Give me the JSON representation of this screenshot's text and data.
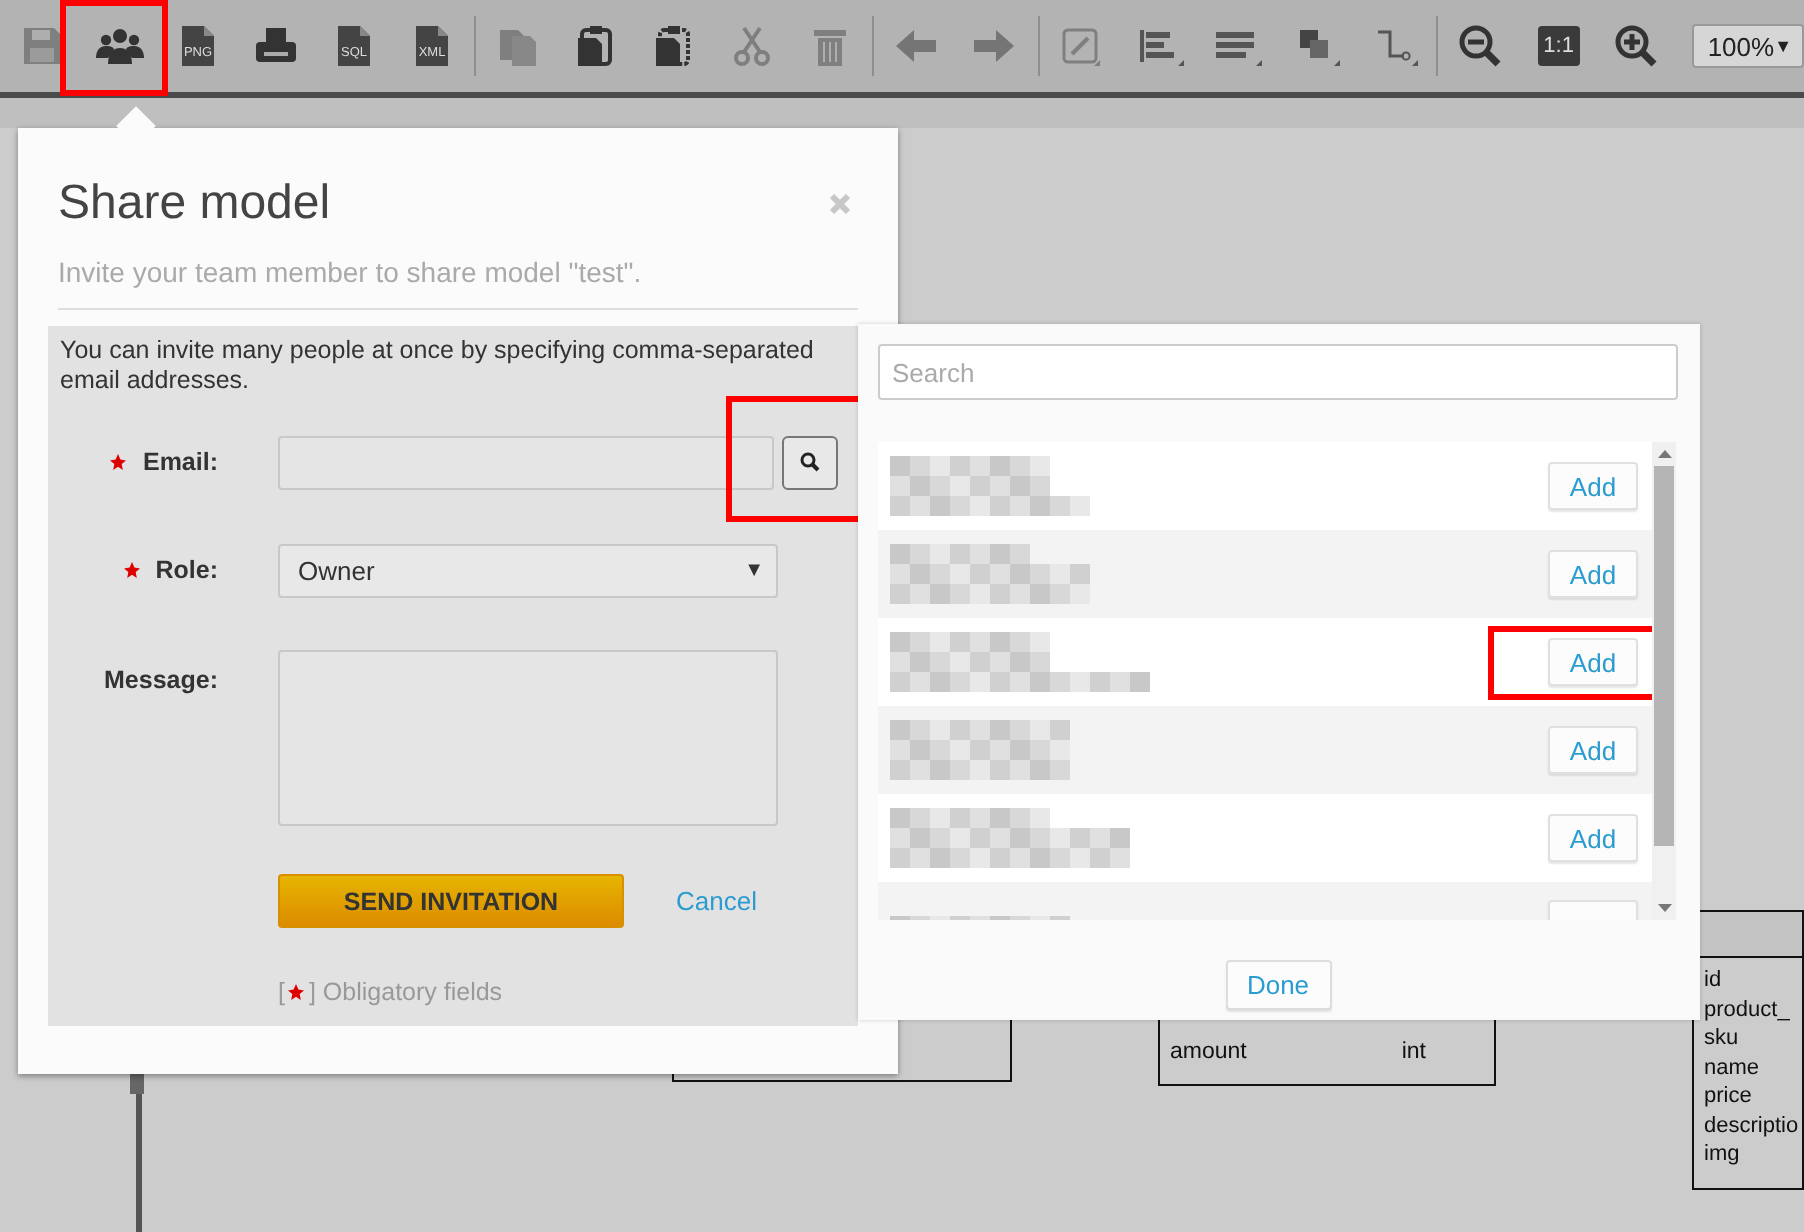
{
  "toolbar": {
    "groups": [
      [
        {
          "kind": "save",
          "disabled": true,
          "highlighted": false
        },
        {
          "kind": "people",
          "disabled": false,
          "highlighted": true
        },
        {
          "kind": "file",
          "label": "PNG",
          "disabled": false,
          "highlighted": false
        },
        {
          "kind": "print",
          "disabled": false,
          "highlighted": false
        },
        {
          "kind": "file",
          "label": "SQL",
          "disabled": false,
          "highlighted": false
        },
        {
          "kind": "file",
          "label": "XML",
          "disabled": false,
          "highlighted": false
        }
      ],
      [
        {
          "kind": "copy",
          "disabled": true,
          "highlighted": false
        },
        {
          "kind": "paste",
          "disabled": false,
          "highlighted": false
        },
        {
          "kind": "paste-special",
          "disabled": false,
          "highlighted": false
        },
        {
          "kind": "cut",
          "disabled": true,
          "highlighted": false
        },
        {
          "kind": "delete",
          "disabled": true,
          "highlighted": false
        }
      ],
      [
        {
          "kind": "back",
          "disabled": true,
          "highlighted": false
        },
        {
          "kind": "forward",
          "disabled": true,
          "highlighted": false
        }
      ],
      [
        {
          "kind": "line",
          "disabled": true,
          "highlighted": false
        },
        {
          "kind": "align",
          "disabled": false,
          "highlighted": false
        },
        {
          "kind": "list",
          "disabled": false,
          "highlighted": false
        },
        {
          "kind": "arrange",
          "disabled": false,
          "highlighted": false
        },
        {
          "kind": "connector",
          "disabled": false,
          "highlighted": false
        }
      ],
      [
        {
          "kind": "zoom-out",
          "disabled": false,
          "highlighted": false
        },
        {
          "kind": "actual-size",
          "label": "1:1",
          "disabled": false,
          "highlighted": false
        },
        {
          "kind": "zoom-in",
          "disabled": false,
          "highlighted": false
        }
      ]
    ],
    "zoom_select": {
      "value": "100%",
      "arrow": "▼"
    }
  },
  "dialog": {
    "title": "Share model",
    "subtitle": "Invite your team member to share model \"test\".",
    "note": "You can invite many people at once by specifying comma-separated email addresses.",
    "fields": [
      {
        "kind": "text",
        "label": "Email:",
        "required": true,
        "search_button": {
          "highlighted": true
        }
      },
      {
        "kind": "select",
        "label": "Role:",
        "required": true,
        "value": "Owner",
        "arrow": "▼"
      },
      {
        "kind": "textarea",
        "label": "Message:",
        "required": false
      }
    ],
    "send_button": "SEND INVITATION",
    "cancel_link": "Cancel",
    "legend": {
      "open": "[",
      "text": "] Obligatory fields"
    }
  },
  "people_panel": {
    "search": {
      "placeholder": "Search"
    },
    "rows": [
      {
        "button": "Add",
        "highlighted": false
      },
      {
        "button": "Add",
        "highlighted": false
      },
      {
        "button": "Add",
        "highlighted": true
      },
      {
        "button": "Add",
        "highlighted": false
      },
      {
        "button": "Add",
        "highlighted": false
      },
      {
        "highlighted": false
      }
    ],
    "done_button": "Done"
  },
  "canvas": {
    "tables": [
      {
        "kind": "plain"
      },
      {
        "kind": "plain",
        "rows": [
          {
            "name": "amount",
            "type": "int"
          }
        ]
      },
      {
        "kind": "headed",
        "rows": [
          {
            "name": "id"
          },
          {
            "name": "product_"
          },
          {
            "name": "sku"
          },
          {
            "name": "name"
          },
          {
            "name": "price"
          },
          {
            "name": "descriptio"
          },
          {
            "name": "img"
          }
        ]
      }
    ]
  }
}
